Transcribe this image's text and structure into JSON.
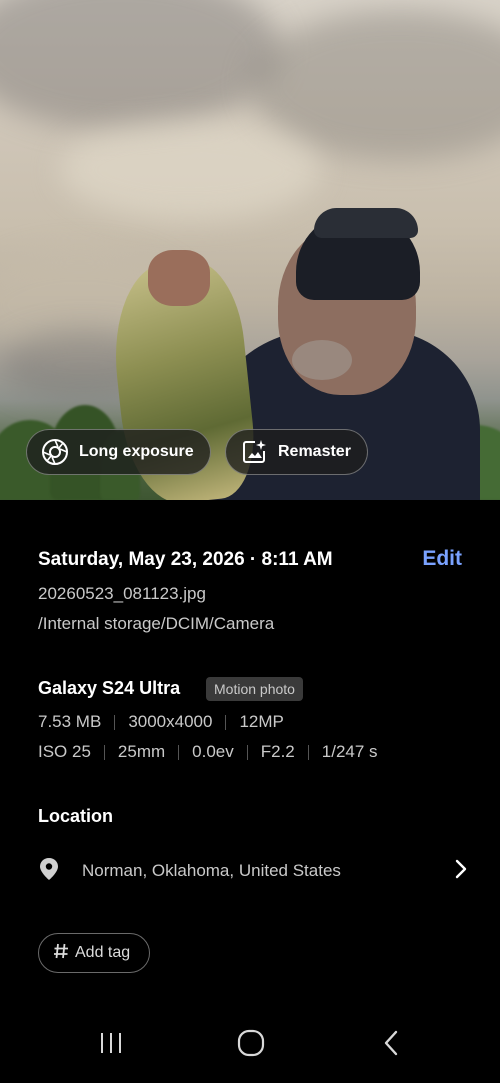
{
  "photo": {
    "chips": {
      "long_exposure": "Long exposure",
      "remaster": "Remaster"
    }
  },
  "details": {
    "date_time": "Saturday, May 23, 2026 · 8:11 AM",
    "edit_label": "Edit",
    "filename": "20260523_081123.jpg",
    "path": "/Internal storage/DCIM/Camera",
    "device": "Galaxy S24 Ultra",
    "badge": "Motion photo",
    "file_size": "7.53 MB",
    "resolution": "3000x4000",
    "megapixels": "12MP",
    "iso": "ISO 25",
    "focal_length": "25mm",
    "exposure_value": "0.0ev",
    "aperture": "F2.2",
    "shutter_speed": "1/247 s"
  },
  "location": {
    "title": "Location",
    "place": "Norman, Oklahoma, United States"
  },
  "tags": {
    "add_tag_label": "Add tag"
  },
  "icons": [
    "long-exposure-icon",
    "remaster-icon",
    "location-pin-icon",
    "chevron-right-icon",
    "hash-icon",
    "recents-icon",
    "home-icon",
    "back-icon"
  ],
  "colors": {
    "accent": "#7aa2ff",
    "background": "#000000"
  }
}
